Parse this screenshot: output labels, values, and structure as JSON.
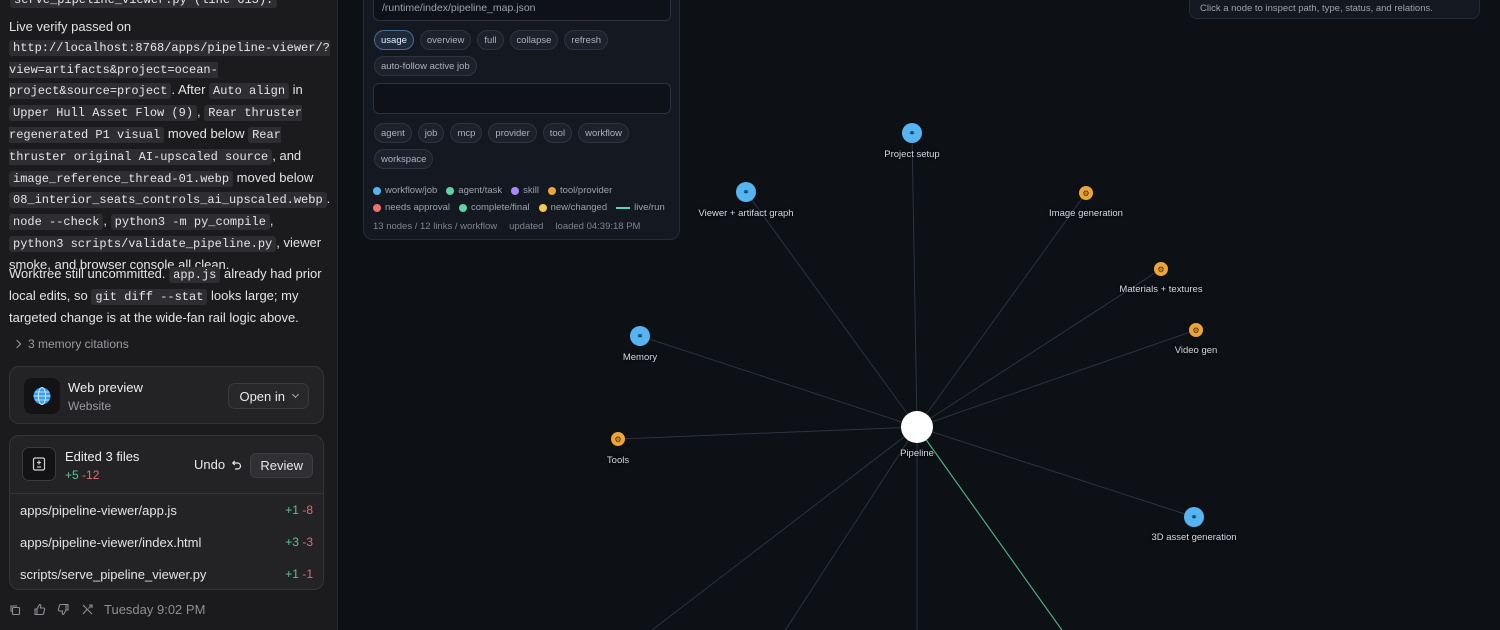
{
  "chat": {
    "top_line": "serve_pipeline_viewer.py (line 613).",
    "para1": {
      "s1": "Live verify passed on",
      "url": "http://localhost:8768/apps/pipeline-viewer/?view=artifacts&project=ocean-project&source=project",
      "s2": ". After",
      "c1": "Auto align",
      "s3": "in",
      "c2": "Upper Hull Asset Flow (9)",
      "s4": ",",
      "c3": "Rear thruster regenerated P1 visual",
      "s5": "moved below",
      "c4": "Rear thruster original AI-upscaled source",
      "s6": ", and",
      "c5": "image_reference_thread-01.webp",
      "s7": "moved below",
      "c6": "08_interior_seats_controls_ai_upscaled.webp",
      "s8": ".",
      "c7": "node --check",
      "s9": ",",
      "c8": "python3 -m py_compile",
      "s10": ",",
      "c9": "python3 scripts/validate_pipeline.py",
      "s11": ", viewer smoke, and browser console all clean."
    },
    "para2": {
      "s1": "Worktree still uncommitted.",
      "c1": "app.js",
      "s2": "already had prior local edits, so",
      "c2": "git diff --stat",
      "s3": "looks large; my targeted change is at the wide-fan rail logic above."
    },
    "citations": "3 memory citations",
    "web_preview": {
      "title": "Web preview",
      "subtitle": "Website",
      "open_in": "Open in"
    },
    "edits": {
      "title": "Edited 3 files",
      "plus": "+5",
      "minus": "-12",
      "undo": "Undo",
      "review": "Review",
      "files": [
        {
          "name": "apps/pipeline-viewer/app.js",
          "plus": "+1",
          "minus": "-8"
        },
        {
          "name": "apps/pipeline-viewer/index.html",
          "plus": "+3",
          "minus": "-3"
        },
        {
          "name": "scripts/serve_pipeline_viewer.py",
          "plus": "+1",
          "minus": "-1"
        }
      ]
    },
    "footer_time": "Tuesday 9:02 PM"
  },
  "viewer": {
    "path": "/runtime/index/pipeline_map.json",
    "view_buttons": [
      "usage",
      "overview",
      "full",
      "collapse",
      "refresh"
    ],
    "active_view": "usage",
    "autofollow": "auto-follow active job",
    "filter_chips": [
      "agent",
      "job",
      "mcp",
      "provider",
      "tool",
      "workflow",
      "workspace"
    ],
    "legend": [
      {
        "label": "workflow/job",
        "color": "#56b4f0",
        "kind": "dot"
      },
      {
        "label": "agent/task",
        "color": "#5fd3a5",
        "kind": "dot"
      },
      {
        "label": "skill",
        "color": "#a78bfa",
        "kind": "dot"
      },
      {
        "label": "tool/provider",
        "color": "#eba53a",
        "kind": "dot"
      },
      {
        "label": "needs approval",
        "color": "#f07070",
        "kind": "dot"
      },
      {
        "label": "complete/final",
        "color": "#5fd3a5",
        "kind": "dot"
      },
      {
        "label": "new/changed",
        "color": "#f2c94c",
        "kind": "dot"
      },
      {
        "label": "live/run",
        "color": "#5fd3a5",
        "kind": "line"
      }
    ],
    "meta": {
      "counts": "13 nodes / 12 links / workflow",
      "updated": "updated",
      "loaded": "loaded 04:39:18 PM"
    },
    "inspector_hint": "Click a node to inspect path, type, status, and relations.",
    "graph": {
      "center": "Pipeline",
      "nodes": [
        {
          "label": "Project setup",
          "type": "workflow"
        },
        {
          "label": "Viewer + artifact graph",
          "type": "workflow"
        },
        {
          "label": "Image generation",
          "type": "tool"
        },
        {
          "label": "Materials + textures",
          "type": "tool"
        },
        {
          "label": "Video gen",
          "type": "tool"
        },
        {
          "label": "Memory",
          "type": "workflow"
        },
        {
          "label": "Tools",
          "type": "tool"
        },
        {
          "label": "3D asset generation",
          "type": "workflow"
        }
      ]
    }
  }
}
